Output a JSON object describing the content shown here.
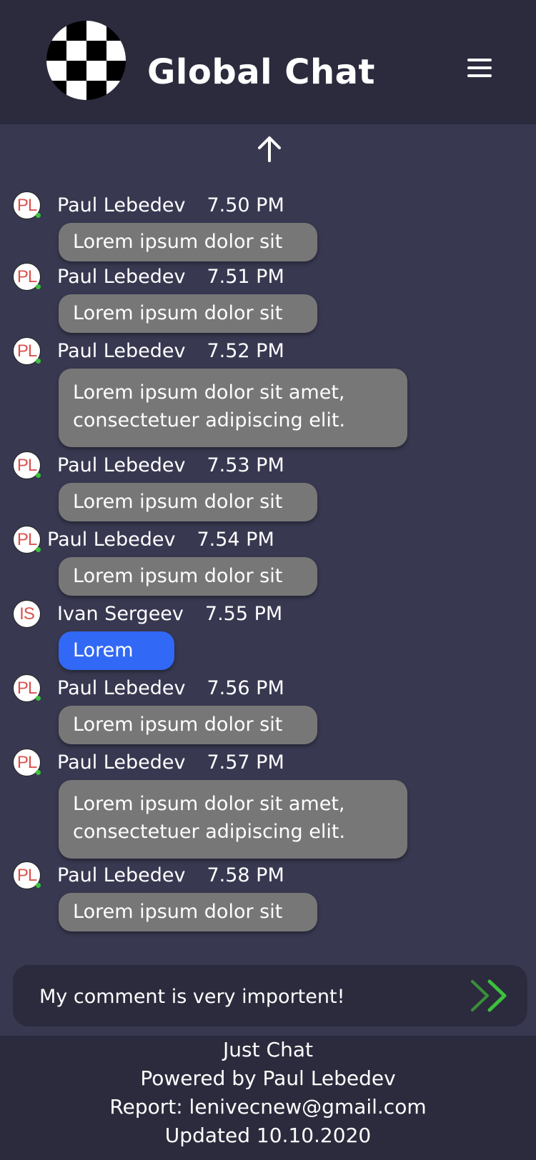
{
  "header": {
    "title": "Global Chat",
    "logo_icon": "checkered-flag-icon",
    "menu_icon": "hamburger-menu-icon"
  },
  "scroll_up_icon": "arrow-up-icon",
  "messages": [
    {
      "initials": "PL",
      "author": "Paul Lebedev",
      "time": "7.50 PM",
      "line1": "Lorem ipsum dolor sit",
      "line2": ""
    },
    {
      "initials": "PL",
      "author": "Paul Lebedev",
      "time": "7.51 PM",
      "line1": "Lorem ipsum dolor sit",
      "line2": ""
    },
    {
      "initials": "PL",
      "author": "Paul Lebedev",
      "time": "7.52 PM",
      "line1": "Lorem ipsum dolor sit amet,",
      "line2": "consectetuer adipiscing elit."
    },
    {
      "initials": "PL",
      "author": "Paul Lebedev",
      "time": "7.53 PM",
      "line1": "Lorem ipsum dolor sit",
      "line2": ""
    },
    {
      "initials": "PL",
      "author": "Paul Lebedev",
      "time": "7.54 PM",
      "line1": "Lorem ipsum dolor sit",
      "line2": ""
    },
    {
      "initials": "IS",
      "author": "Ivan Sergeev",
      "time": "7.55 PM",
      "line1": "Lorem",
      "line2": ""
    },
    {
      "initials": "PL",
      "author": "Paul Lebedev",
      "time": "7.56 PM",
      "line1": "Lorem ipsum dolor sit",
      "line2": ""
    },
    {
      "initials": "PL",
      "author": "Paul Lebedev",
      "time": "7.57 PM",
      "line1": "Lorem ipsum dolor sit amet,",
      "line2": "consectetuer adipiscing elit."
    },
    {
      "initials": "PL",
      "author": "Paul Lebedev",
      "time": "7.58 PM",
      "line1": "Lorem ipsum dolor sit",
      "line2": ""
    }
  ],
  "composer": {
    "value": "My comment is very importent!",
    "send_icon": "double-chevron-right-icon"
  },
  "footer": {
    "line1": "Just Chat",
    "line2": "Powered by Paul Lebedev",
    "line3": "Report:  lenivecnew@gmail.com",
    "line4": "Updated 10.10.2020"
  },
  "colors": {
    "background": "#383851",
    "header": "#2b2b3d",
    "bubble_other": "#777777",
    "bubble_self": "#3168f5",
    "online": "#3cc13c",
    "send": "#3cc13c"
  }
}
